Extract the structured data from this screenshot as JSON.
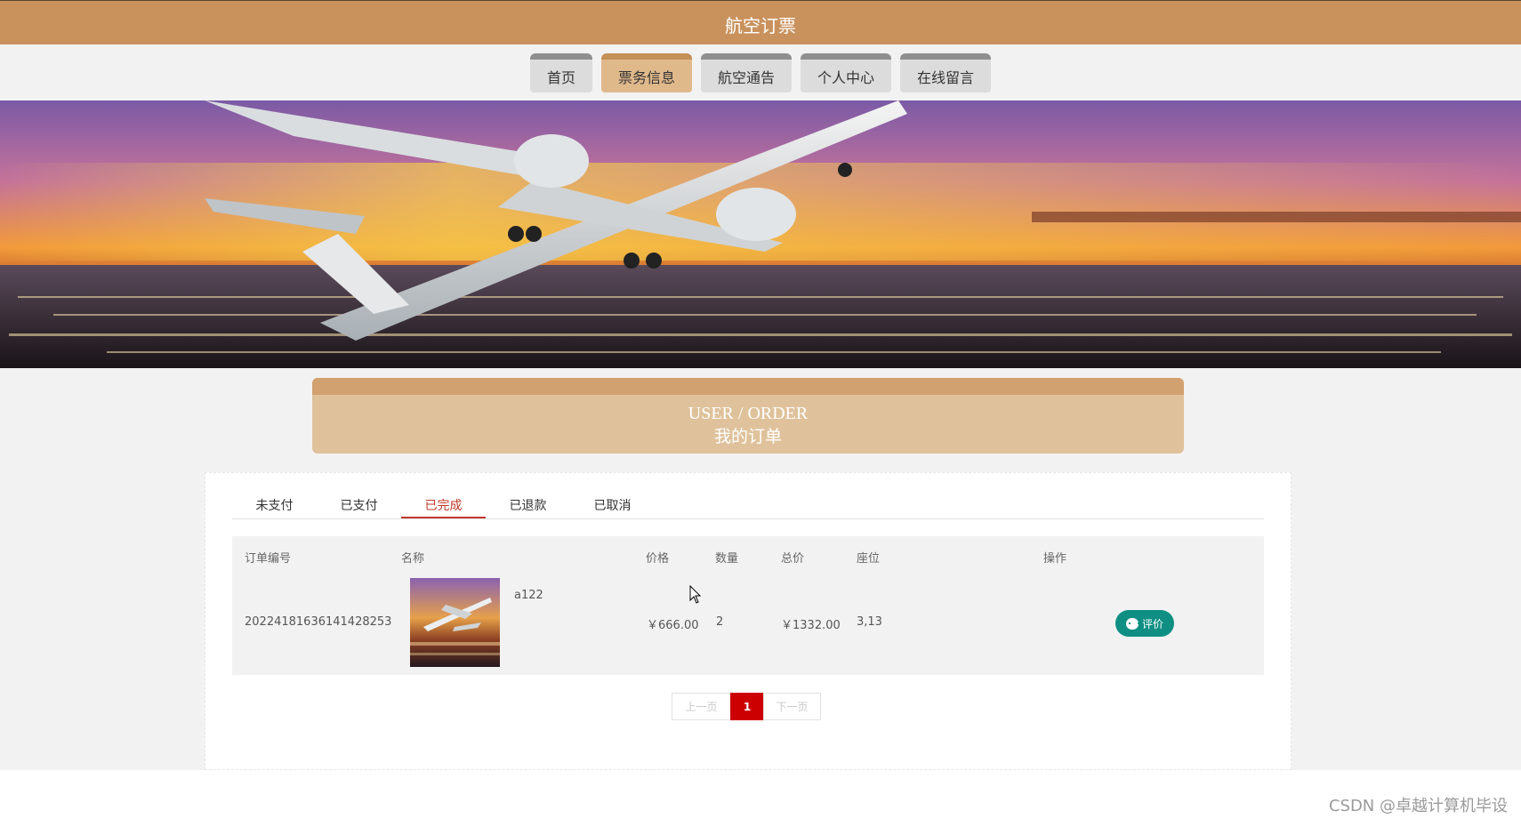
{
  "app": {
    "title": "航空订票"
  },
  "nav": {
    "items": [
      {
        "label": "首页",
        "active": false
      },
      {
        "label": "票务信息",
        "active": true
      },
      {
        "label": "航空通告",
        "active": false
      },
      {
        "label": "个人中心",
        "active": false
      },
      {
        "label": "在线留言",
        "active": false
      }
    ]
  },
  "section": {
    "title_en": "USER / ORDER",
    "title_cn": "我的订单"
  },
  "tabs": [
    {
      "label": "未支付",
      "active": false
    },
    {
      "label": "已支付",
      "active": false
    },
    {
      "label": "已完成",
      "active": true
    },
    {
      "label": "已退款",
      "active": false
    },
    {
      "label": "已取消",
      "active": false
    }
  ],
  "table": {
    "headers": [
      "订单编号",
      "名称",
      "价格",
      "数量",
      "总价",
      "座位",
      "操作"
    ],
    "rows": [
      {
        "order_no": "20224181636141428253",
        "name": "a122",
        "price": "￥666.00",
        "quantity": "2",
        "total": "￥1332.00",
        "seat": "3,13",
        "action": "评价"
      }
    ]
  },
  "pagination": {
    "prev": "上一页",
    "current": "1",
    "next": "下一页"
  },
  "watermark": "CSDN @卓越计算机毕设",
  "colors": {
    "brand": "#c9925d",
    "accent": "#c00",
    "action": "#0f8f84"
  }
}
